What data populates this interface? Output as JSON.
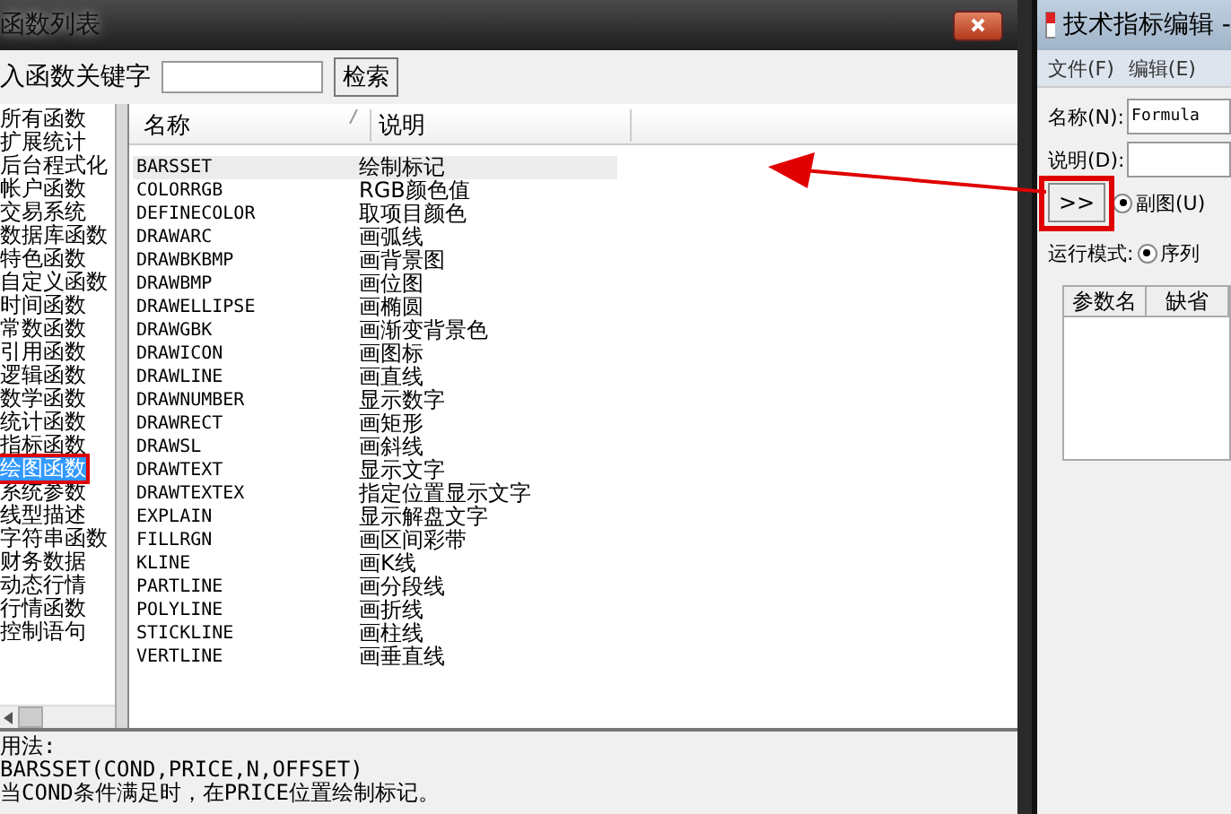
{
  "left_window": {
    "title": "函数列表",
    "search_label": "入函数关键字",
    "search_button": "检索",
    "categories": [
      {
        "label": "所有函数",
        "selected": false
      },
      {
        "label": "扩展统计",
        "selected": false
      },
      {
        "label": "后台程式化",
        "selected": false
      },
      {
        "label": "帐户函数",
        "selected": false
      },
      {
        "label": "交易系统",
        "selected": false
      },
      {
        "label": "数据库函数",
        "selected": false
      },
      {
        "label": "特色函数",
        "selected": false
      },
      {
        "label": "自定义函数",
        "selected": false
      },
      {
        "label": "时间函数",
        "selected": false
      },
      {
        "label": "常数函数",
        "selected": false
      },
      {
        "label": "引用函数",
        "selected": false
      },
      {
        "label": "逻辑函数",
        "selected": false
      },
      {
        "label": "数学函数",
        "selected": false
      },
      {
        "label": "统计函数",
        "selected": false
      },
      {
        "label": "指标函数",
        "selected": false
      },
      {
        "label": "绘图函数",
        "selected": true
      },
      {
        "label": "系统参数",
        "selected": false
      },
      {
        "label": "线型描述",
        "selected": false
      },
      {
        "label": "字符串函数",
        "selected": false
      },
      {
        "label": "财务数据",
        "selected": false
      },
      {
        "label": "动态行情",
        "selected": false
      },
      {
        "label": "行情函数",
        "selected": false
      },
      {
        "label": "控制语句",
        "selected": false
      }
    ],
    "table": {
      "columns": [
        "名称",
        "说明"
      ],
      "rows": [
        {
          "name": "BARSSET",
          "desc": "绘制标记",
          "selected": true
        },
        {
          "name": "COLORRGB",
          "desc": "RGB颜色值",
          "selected": false
        },
        {
          "name": "DEFINECOLOR",
          "desc": "取项目颜色",
          "selected": false
        },
        {
          "name": "DRAWARC",
          "desc": "画弧线",
          "selected": false
        },
        {
          "name": "DRAWBKBMP",
          "desc": "画背景图",
          "selected": false
        },
        {
          "name": "DRAWBMP",
          "desc": "画位图",
          "selected": false
        },
        {
          "name": "DRAWELLIPSE",
          "desc": "画椭圆",
          "selected": false
        },
        {
          "name": "DRAWGBK",
          "desc": "画渐变背景色",
          "selected": false
        },
        {
          "name": "DRAWICON",
          "desc": "画图标",
          "selected": false
        },
        {
          "name": "DRAWLINE",
          "desc": "画直线",
          "selected": false
        },
        {
          "name": "DRAWNUMBER",
          "desc": "显示数字",
          "selected": false
        },
        {
          "name": "DRAWRECT",
          "desc": "画矩形",
          "selected": false
        },
        {
          "name": "DRAWSL",
          "desc": "画斜线",
          "selected": false
        },
        {
          "name": "DRAWTEXT",
          "desc": "显示文字",
          "selected": false
        },
        {
          "name": "DRAWTEXTEX",
          "desc": "指定位置显示文字",
          "selected": false
        },
        {
          "name": "EXPLAIN",
          "desc": "显示解盘文字",
          "selected": false
        },
        {
          "name": "FILLRGN",
          "desc": "画区间彩带",
          "selected": false
        },
        {
          "name": "KLINE",
          "desc": "画K线",
          "selected": false
        },
        {
          "name": "PARTLINE",
          "desc": "画分段线",
          "selected": false
        },
        {
          "name": "POLYLINE",
          "desc": "画折线",
          "selected": false
        },
        {
          "name": "STICKLINE",
          "desc": "画柱线",
          "selected": false
        },
        {
          "name": "VERTLINE",
          "desc": "画垂直线",
          "selected": false
        }
      ]
    },
    "usage": [
      "用法:",
      "BARSSET(COND,PRICE,N,OFFSET)",
      "当COND条件满足时，在PRICE位置绘制标记。"
    ]
  },
  "right_window": {
    "title": "技术指标编辑 -",
    "menu": [
      "文件(F)",
      "编辑(E)"
    ],
    "name_label": "名称(N):",
    "name_value": "Formula",
    "desc_label": "说明(D):",
    "expand_button": ">>",
    "chart_radio": {
      "label": "副图(U)",
      "selected": true
    },
    "mode_label": "运行模式:",
    "mode_radio": {
      "label": "序列",
      "selected": true
    },
    "param_columns": [
      "参数名",
      "缺省"
    ]
  }
}
